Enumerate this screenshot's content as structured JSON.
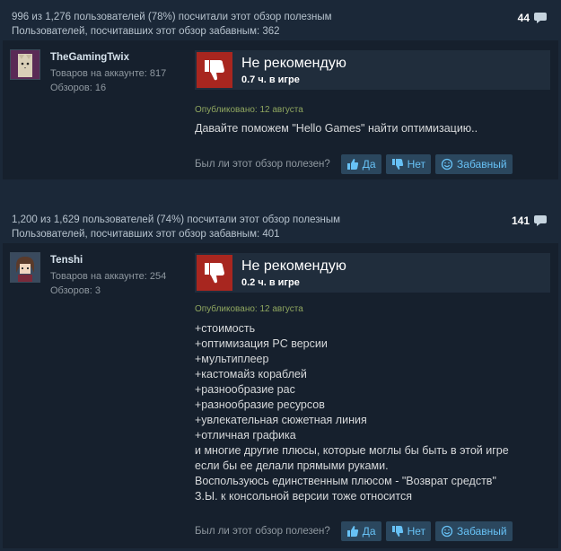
{
  "colors": {
    "page_bg": "#1b2838",
    "card_bg": "#16202d",
    "thumb_down_bg": "#a8261f",
    "link_blue": "#67c1f5",
    "button_bg": "#2b475e",
    "posted_green": "#8fa65f"
  },
  "common": {
    "verdict": "Не рекомендую",
    "helpful_question": "Был ли этот обзор полезен?",
    "yes_label": "Да",
    "no_label": "Нет",
    "funny_label": "Забавный"
  },
  "reviews": [
    {
      "helpful_line": "996 из 1,276 пользователей (78%) посчитали этот обзор полезным",
      "funny_line": "Пользователей, посчитавших этот обзор забавным: 362",
      "comment_count": "44",
      "author": {
        "name": "TheGamingTwix",
        "products_line": "Товаров на аккаунте: 817",
        "reviews_line": "Обзоров: 16",
        "avatar_icon": "cat-avatar-icon"
      },
      "playtime": "0.7 ч. в игре",
      "posted": "Опубликовано: 12 августа",
      "text": "Давайте поможем \"Hello Games\" найти оптимизацию.."
    },
    {
      "helpful_line": "1,200 из 1,629 пользователей (74%) посчитали этот обзор полезным",
      "funny_line": "Пользователей, посчитавших этот обзор забавным: 401",
      "comment_count": "141",
      "author": {
        "name": "Tenshi",
        "products_line": "Товаров на аккаунте: 254",
        "reviews_line": "Обзоров: 3",
        "avatar_icon": "anime-avatar-icon"
      },
      "playtime": "0.2 ч. в игре",
      "posted": "Опубликовано: 12 августа",
      "text": "+стоимость\n+оптимизация PC версии\n+мультиплеер\n+кастомайз кораблей\n+разнообразие рас\n+разнообразие ресурсов\n+увлекательная сюжетная линия\n+отличная графика\nи многие другие плюсы, которые моглы бы быть в этой игре\nесли бы ее делали прямыми руками.\nВоспользуюсь единственным плюсом - \"Возврат средств\"\nЗ.Ы. к консольной версии тоже относится"
    }
  ]
}
